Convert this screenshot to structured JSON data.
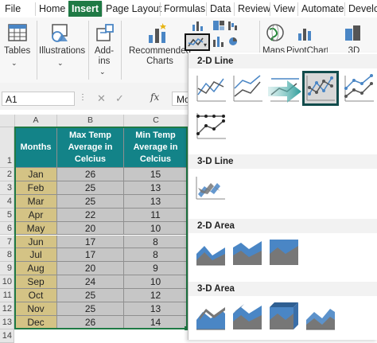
{
  "menu": {
    "tabs": [
      "File",
      "Home",
      "Insert",
      "Page Layout",
      "Formulas",
      "Data",
      "Review",
      "View",
      "Automate",
      "Develo"
    ]
  },
  "ribbon": {
    "tables": "Tables",
    "illustrations": "Illustrations",
    "addins_line1": "Add-",
    "addins_line2": "ins",
    "recommended_line1": "Recommended",
    "recommended_line2": "Charts",
    "maps": "Maps",
    "pivotchart": "PivotChart",
    "threed": "3D"
  },
  "formula": {
    "namebox": "A1",
    "fx": "fx",
    "content": "Mo"
  },
  "sheet": {
    "columns": [
      "A",
      "B",
      "C"
    ],
    "row_numbers": [
      "1",
      "2",
      "3",
      "4",
      "5",
      "6",
      "7",
      "8",
      "9",
      "10",
      "11",
      "12",
      "13",
      "14"
    ],
    "header": [
      "Months",
      "Max Temp Average in Celcius",
      "Min Temp Average in Celcius"
    ],
    "rows": [
      [
        "Jan",
        "26",
        "15"
      ],
      [
        "Feb",
        "25",
        "13"
      ],
      [
        "Mar",
        "25",
        "13"
      ],
      [
        "Apr",
        "22",
        "11"
      ],
      [
        "May",
        "20",
        "10"
      ],
      [
        "Jun",
        "17",
        "8"
      ],
      [
        "Jul",
        "17",
        "8"
      ],
      [
        "Aug",
        "20",
        "9"
      ],
      [
        "Sep",
        "24",
        "10"
      ],
      [
        "Oct",
        "25",
        "12"
      ],
      [
        "Nov",
        "25",
        "13"
      ],
      [
        "Dec",
        "26",
        "14"
      ]
    ]
  },
  "gallery": {
    "sections": [
      "2-D Line",
      "3-D Line",
      "2-D Area",
      "3-D Area"
    ]
  },
  "colors": {
    "excel_green": "#1f7a45",
    "header_teal": "#138388",
    "month_tan": "#d4c385",
    "value_grey": "#c6c6c6",
    "chart_blue": "#4a86c5",
    "arrow_teal": "#2a9a98"
  }
}
